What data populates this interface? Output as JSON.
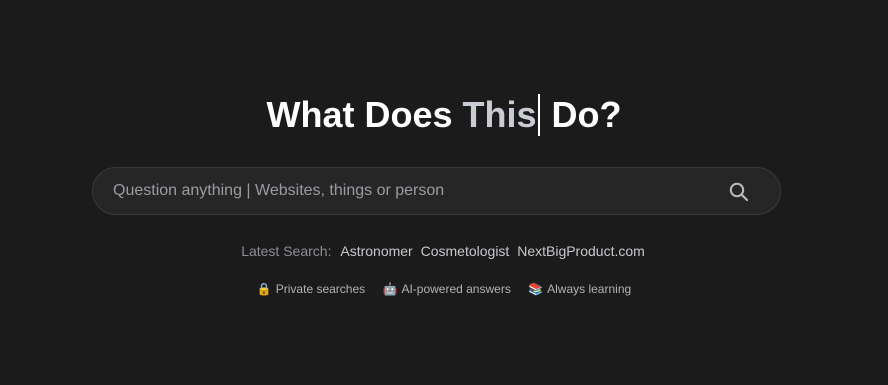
{
  "hero": {
    "title_before": "What Does",
    "title_highlight": "This",
    "title_after": "Do?"
  },
  "search": {
    "placeholder": "Question anything | Websites, things or person",
    "value": "",
    "button_icon": "search-icon"
  },
  "latest": {
    "label": "Latest Search:",
    "items": [
      "Astronomer",
      "Cosmetologist",
      "NextBigProduct.com"
    ]
  },
  "features": [
    {
      "icon": "lock-icon",
      "emoji": "🔒",
      "label": "Private searches"
    },
    {
      "icon": "robot-icon",
      "emoji": "🤖",
      "label": "AI-powered answers"
    },
    {
      "icon": "books-icon",
      "emoji": "📚",
      "label": "Always learning"
    }
  ],
  "colors": {
    "background": "#1b1b1c",
    "search_bg": "#262627",
    "highlight": "#c9ccd2"
  }
}
